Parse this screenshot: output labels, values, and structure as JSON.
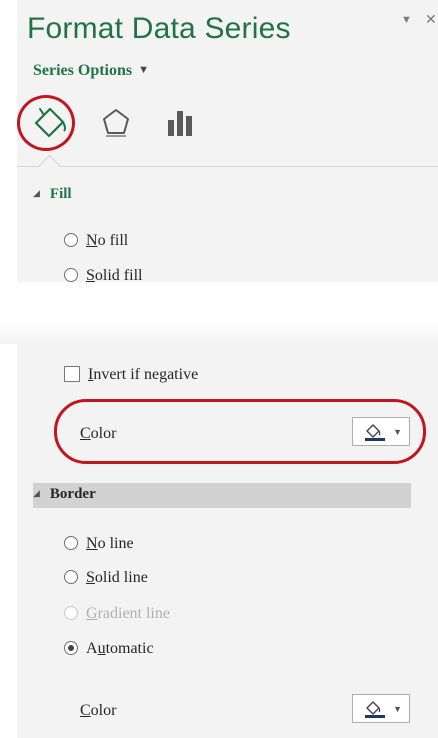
{
  "pane": {
    "title": "Format Data Series",
    "menu_icon": "triangle-down",
    "close_icon": "close-x"
  },
  "series_options": {
    "label": "Series Options"
  },
  "tabs": [
    {
      "name": "Fill & Line",
      "icon": "paint-bucket"
    },
    {
      "name": "Effects",
      "icon": "pentagon"
    },
    {
      "name": "Series Options",
      "icon": "bar-chart"
    }
  ],
  "fill": {
    "header": "Fill",
    "options": [
      {
        "label": "No fill",
        "hotkey": "N",
        "rest": "o fill",
        "selected": false,
        "enabled": true
      },
      {
        "label": "Solid fill",
        "hotkey": "S",
        "rest": "olid fill",
        "selected": false,
        "enabled": true
      }
    ],
    "invert": {
      "hotkey": "I",
      "rest": "nvert if negative",
      "checked": false
    },
    "color": {
      "hotkey": "C",
      "rest": "olor",
      "swatch": "#1f3864"
    }
  },
  "border": {
    "header": "Border",
    "options": [
      {
        "label": "No line",
        "hotkey": "N",
        "rest": "o line",
        "selected": false,
        "enabled": true
      },
      {
        "label": "Solid line",
        "hotkey": "S",
        "rest": "olid line",
        "selected": false,
        "enabled": true
      },
      {
        "label": "Gradient line",
        "hotkey": "G",
        "rest": "radient line",
        "selected": false,
        "enabled": false
      },
      {
        "label": "Automatic",
        "pre": "A",
        "hotkey": "u",
        "rest": "tomatic",
        "selected": true,
        "enabled": true
      }
    ],
    "color": {
      "hotkey": "C",
      "rest": "olor",
      "swatch": "#1f3864"
    }
  },
  "colors": {
    "accent": "#217346",
    "highlight": "#c0161f",
    "pane_bg": "#f3f3f3"
  }
}
